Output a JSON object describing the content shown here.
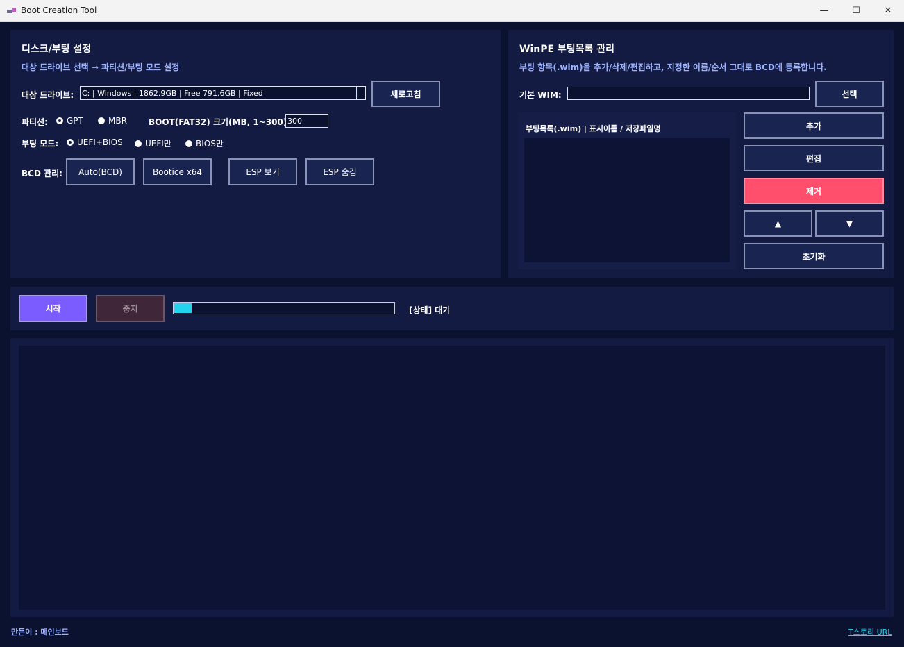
{
  "window": {
    "title": "Boot Creation Tool",
    "controls": {
      "minimize": "—",
      "maximize": "☐",
      "close": "✕"
    }
  },
  "disk": {
    "title": "디스크/부팅 설정",
    "subtitle": "대상 드라이브 선택 → 파티션/부팅 모드 설정",
    "drive_label": "대상 드라이브:",
    "drive_value": "C: | Windows | 1862.9GB | Free 791.6GB | Fixed",
    "refresh": "새로고침",
    "partition_label": "파티션:",
    "partition_options": [
      "GPT",
      "MBR"
    ],
    "partition_selected": "GPT",
    "boot_size_label": "BOOT(FAT32) 크기(MB, 1~300):",
    "boot_size_value": "300",
    "boot_mode_label": "부팅 모드:",
    "boot_mode_options": [
      "UEFI+BIOS",
      "UEFI만",
      "BIOS만"
    ],
    "boot_mode_selected": "UEFI+BIOS",
    "bcd_label": "BCD 관리:",
    "bcd_buttons": [
      "Auto(BCD)",
      "Bootice x64",
      "ESP 보기",
      "ESP 숨김"
    ]
  },
  "winpe": {
    "title": "WinPE 부팅목록 관리",
    "subtitle": "부팅 항목(.wim)을 추가/삭제/편집하고, 지정한 이름/순서 그대로 BCD에 등록합니다.",
    "wim_label": "기본 WIM:",
    "wim_value": "",
    "select": "선택",
    "list_header": "부팅목록(.wim)  |  표시이름 / 저장파일명",
    "buttons": {
      "add": "추가",
      "edit": "편집",
      "remove": "제거",
      "up": "▲",
      "down": "▼",
      "reset": "초기화"
    }
  },
  "run": {
    "start": "시작",
    "stop": "중지",
    "progress": 0.08,
    "status": "[상태] 대기"
  },
  "footer": {
    "maker": "만든이 : 메인보드",
    "link": "T스토리 URL"
  },
  "colors": {
    "background": "#0b1230",
    "panel": "#131b43",
    "accent": "#9fb4ff",
    "start": "#7b5cff",
    "danger": "#ff4f6d",
    "progress": "#22d3ee"
  }
}
